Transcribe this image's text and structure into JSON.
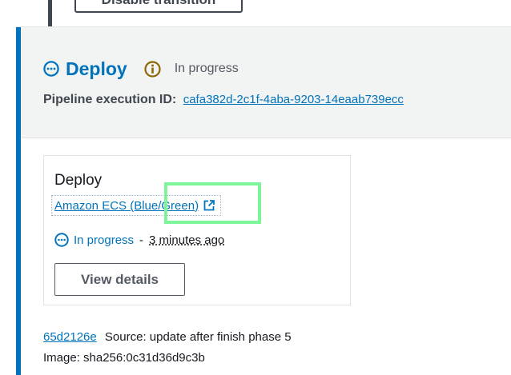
{
  "transition": {
    "disable_label": "Disable transition"
  },
  "stage": {
    "title": "Deploy",
    "status": "In progress",
    "execution_id_label": "Pipeline execution ID:",
    "execution_id": "cafa382d-2c1f-4aba-9203-14eaab739ecc",
    "accent_color": "#0073bb"
  },
  "action": {
    "name": "Deploy",
    "provider_link": "Amazon ECS (Blue/Green)",
    "status": "In progress",
    "separator": "-",
    "time": "3 minutes ago",
    "view_details_label": "View details"
  },
  "artifact": {
    "commit_id": "65d2126e",
    "source_message": "Source: update after finish phase 5",
    "image": "Image: sha256:0c31d36d9c3b"
  },
  "icons": {
    "status": "in-progress-circle-dots-icon",
    "info": "info-icon",
    "external": "external-link-icon"
  },
  "highlight_color": "#7ef59b"
}
